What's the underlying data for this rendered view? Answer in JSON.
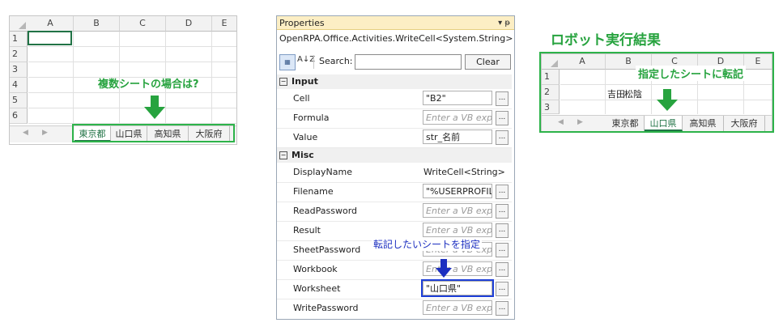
{
  "sheet_left": {
    "columns": [
      "A",
      "B",
      "C",
      "D",
      "E"
    ],
    "rows": [
      "1",
      "2",
      "3",
      "4",
      "5",
      "6"
    ],
    "tabs": [
      "東京都",
      "山口県",
      "高知県",
      "大阪府"
    ],
    "callout": "複数シートの場合は?"
  },
  "properties": {
    "title": "Properties",
    "title_icons": "▾ ᵽ",
    "class_name": "OpenRPA.Office.Activities.WriteCell<System.String>",
    "sort_icon": "▦",
    "az_icon": "A↓Z",
    "search_label": "Search:",
    "clear_label": "Clear",
    "sections": [
      {
        "name": "Input",
        "rows": [
          {
            "name": "Cell",
            "value": "\"B2\"",
            "placeholder": false
          },
          {
            "name": "Formula",
            "value": "Enter a VB expr",
            "placeholder": true
          },
          {
            "name": "Value",
            "value": "str_名前",
            "placeholder": false
          }
        ]
      },
      {
        "name": "Misc",
        "rows": [
          {
            "name": "DisplayName",
            "value": "WriteCell<String>",
            "placeholder": false
          },
          {
            "name": "Filename",
            "value": "\"%USERPROFIL",
            "placeholder": false
          },
          {
            "name": "ReadPassword",
            "value": "Enter a VB expr",
            "placeholder": true
          },
          {
            "name": "Result",
            "value": "Enter a VB expr",
            "placeholder": true
          },
          {
            "name": "SheetPassword",
            "value": "Enter a VB expr",
            "placeholder": true
          },
          {
            "name": "Workbook",
            "value": "Enter a VB expr",
            "placeholder": true
          },
          {
            "name": "Worksheet",
            "value": "\"山口県\"",
            "placeholder": false
          },
          {
            "name": "WritePassword",
            "value": "Enter a VB expr",
            "placeholder": true
          }
        ]
      }
    ],
    "dots_label": "...",
    "callout": "転記したいシートを指定"
  },
  "result": {
    "title": "ロボット実行結果",
    "columns": [
      "A",
      "B",
      "C",
      "D",
      "E"
    ],
    "rows": [
      "1",
      "2",
      "3"
    ],
    "cell_b2": "吉田",
    "cell_c2": "松陰",
    "tabs": [
      "東京都",
      "山口県",
      "高知県",
      "大阪府"
    ],
    "callout": "指定したシートに転記"
  },
  "colors": {
    "accent_green": "#27a33f",
    "callout_blue": "#1c2fc0",
    "title_bar": "#fceec4"
  }
}
